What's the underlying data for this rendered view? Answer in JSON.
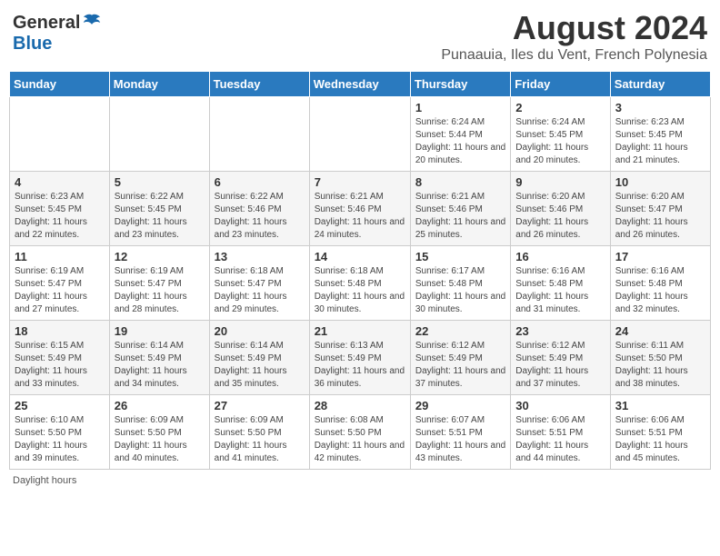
{
  "header": {
    "logo_general": "General",
    "logo_blue": "Blue",
    "title": "August 2024",
    "subtitle": "Punaauia, Iles du Vent, French Polynesia"
  },
  "days_of_week": [
    "Sunday",
    "Monday",
    "Tuesday",
    "Wednesday",
    "Thursday",
    "Friday",
    "Saturday"
  ],
  "weeks": [
    [
      {
        "num": "",
        "info": ""
      },
      {
        "num": "",
        "info": ""
      },
      {
        "num": "",
        "info": ""
      },
      {
        "num": "",
        "info": ""
      },
      {
        "num": "1",
        "info": "Sunrise: 6:24 AM\nSunset: 5:44 PM\nDaylight: 11 hours and 20 minutes."
      },
      {
        "num": "2",
        "info": "Sunrise: 6:24 AM\nSunset: 5:45 PM\nDaylight: 11 hours and 20 minutes."
      },
      {
        "num": "3",
        "info": "Sunrise: 6:23 AM\nSunset: 5:45 PM\nDaylight: 11 hours and 21 minutes."
      }
    ],
    [
      {
        "num": "4",
        "info": "Sunrise: 6:23 AM\nSunset: 5:45 PM\nDaylight: 11 hours and 22 minutes."
      },
      {
        "num": "5",
        "info": "Sunrise: 6:22 AM\nSunset: 5:45 PM\nDaylight: 11 hours and 23 minutes."
      },
      {
        "num": "6",
        "info": "Sunrise: 6:22 AM\nSunset: 5:46 PM\nDaylight: 11 hours and 23 minutes."
      },
      {
        "num": "7",
        "info": "Sunrise: 6:21 AM\nSunset: 5:46 PM\nDaylight: 11 hours and 24 minutes."
      },
      {
        "num": "8",
        "info": "Sunrise: 6:21 AM\nSunset: 5:46 PM\nDaylight: 11 hours and 25 minutes."
      },
      {
        "num": "9",
        "info": "Sunrise: 6:20 AM\nSunset: 5:46 PM\nDaylight: 11 hours and 26 minutes."
      },
      {
        "num": "10",
        "info": "Sunrise: 6:20 AM\nSunset: 5:47 PM\nDaylight: 11 hours and 26 minutes."
      }
    ],
    [
      {
        "num": "11",
        "info": "Sunrise: 6:19 AM\nSunset: 5:47 PM\nDaylight: 11 hours and 27 minutes."
      },
      {
        "num": "12",
        "info": "Sunrise: 6:19 AM\nSunset: 5:47 PM\nDaylight: 11 hours and 28 minutes."
      },
      {
        "num": "13",
        "info": "Sunrise: 6:18 AM\nSunset: 5:47 PM\nDaylight: 11 hours and 29 minutes."
      },
      {
        "num": "14",
        "info": "Sunrise: 6:18 AM\nSunset: 5:48 PM\nDaylight: 11 hours and 30 minutes."
      },
      {
        "num": "15",
        "info": "Sunrise: 6:17 AM\nSunset: 5:48 PM\nDaylight: 11 hours and 30 minutes."
      },
      {
        "num": "16",
        "info": "Sunrise: 6:16 AM\nSunset: 5:48 PM\nDaylight: 11 hours and 31 minutes."
      },
      {
        "num": "17",
        "info": "Sunrise: 6:16 AM\nSunset: 5:48 PM\nDaylight: 11 hours and 32 minutes."
      }
    ],
    [
      {
        "num": "18",
        "info": "Sunrise: 6:15 AM\nSunset: 5:49 PM\nDaylight: 11 hours and 33 minutes."
      },
      {
        "num": "19",
        "info": "Sunrise: 6:14 AM\nSunset: 5:49 PM\nDaylight: 11 hours and 34 minutes."
      },
      {
        "num": "20",
        "info": "Sunrise: 6:14 AM\nSunset: 5:49 PM\nDaylight: 11 hours and 35 minutes."
      },
      {
        "num": "21",
        "info": "Sunrise: 6:13 AM\nSunset: 5:49 PM\nDaylight: 11 hours and 36 minutes."
      },
      {
        "num": "22",
        "info": "Sunrise: 6:12 AM\nSunset: 5:49 PM\nDaylight: 11 hours and 37 minutes."
      },
      {
        "num": "23",
        "info": "Sunrise: 6:12 AM\nSunset: 5:49 PM\nDaylight: 11 hours and 37 minutes."
      },
      {
        "num": "24",
        "info": "Sunrise: 6:11 AM\nSunset: 5:50 PM\nDaylight: 11 hours and 38 minutes."
      }
    ],
    [
      {
        "num": "25",
        "info": "Sunrise: 6:10 AM\nSunset: 5:50 PM\nDaylight: 11 hours and 39 minutes."
      },
      {
        "num": "26",
        "info": "Sunrise: 6:09 AM\nSunset: 5:50 PM\nDaylight: 11 hours and 40 minutes."
      },
      {
        "num": "27",
        "info": "Sunrise: 6:09 AM\nSunset: 5:50 PM\nDaylight: 11 hours and 41 minutes."
      },
      {
        "num": "28",
        "info": "Sunrise: 6:08 AM\nSunset: 5:50 PM\nDaylight: 11 hours and 42 minutes."
      },
      {
        "num": "29",
        "info": "Sunrise: 6:07 AM\nSunset: 5:51 PM\nDaylight: 11 hours and 43 minutes."
      },
      {
        "num": "30",
        "info": "Sunrise: 6:06 AM\nSunset: 5:51 PM\nDaylight: 11 hours and 44 minutes."
      },
      {
        "num": "31",
        "info": "Sunrise: 6:06 AM\nSunset: 5:51 PM\nDaylight: 11 hours and 45 minutes."
      }
    ]
  ],
  "footer": {
    "note": "Daylight hours"
  }
}
